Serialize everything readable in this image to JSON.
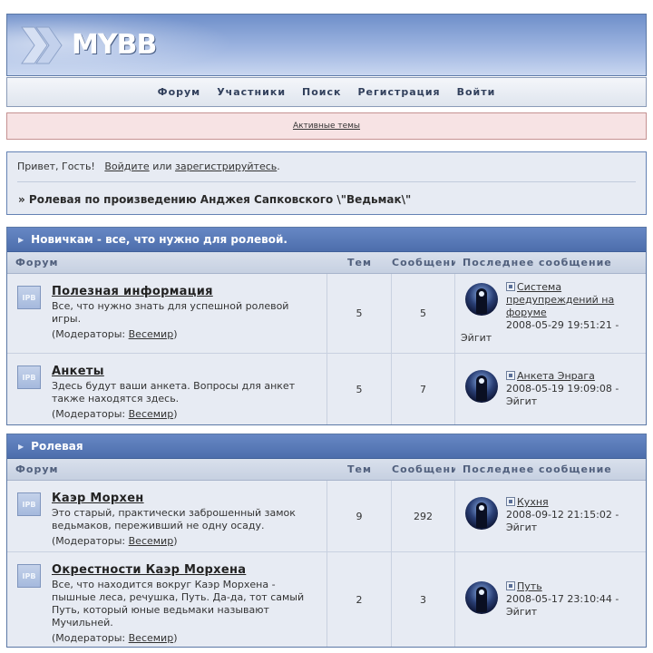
{
  "header": {
    "logo_text": "MYBB"
  },
  "nav": [
    "Форум",
    "Участники",
    "Поиск",
    "Регистрация",
    "Войти"
  ],
  "notice": {
    "link": "Активные темы"
  },
  "welcome": {
    "greet_prefix": "Привет, Гость!",
    "login": "Войдите",
    "or": "или",
    "register": "зарегистрируйтесь",
    "period": ".",
    "board_title": "» Ролевая по произведению Анджея Сапковского \\\"Ведьмак\\\""
  },
  "columns": {
    "forum": "Форум",
    "topics": "Тем",
    "posts": "Сообщений",
    "last": "Последнее сообщение"
  },
  "icons": {
    "forum_icon_text": "IPB"
  },
  "moderators_label": "(Модераторы:",
  "moderators_close": ")",
  "categories": [
    {
      "title": "Новичкам - все, что нужно для ролевой.",
      "forums": [
        {
          "title": "Полезная информация",
          "desc": "Все, что нужно знать для успешной ролевой игры.",
          "moderator": "Весемир",
          "topics": "5",
          "posts": "5",
          "last_topic": "Система предупреждений на форуме",
          "last_date": "2008-05-29 19:51:21 -",
          "last_author": "Эйгит"
        },
        {
          "title": "Анкеты",
          "desc": "Здесь будут ваши анкета. Вопросы для анкет также находятся здесь.",
          "moderator": "Весемир",
          "topics": "5",
          "posts": "7",
          "last_topic": "Анкета Энрага",
          "last_date": "2008-05-19 19:09:08 -",
          "last_author": "Эйгит"
        }
      ]
    },
    {
      "title": "Ролевая",
      "forums": [
        {
          "title": "Каэр Морхен",
          "desc": "Это старый, практически заброшенный замок ведьмаков, переживший не одну осаду.",
          "moderator": "Весемир",
          "topics": "9",
          "posts": "292",
          "last_topic": "Кухня",
          "last_date": "2008-09-12 21:15:02 -",
          "last_author": "Эйгит"
        },
        {
          "title": "Окрестности Каэр Морхена",
          "desc": "Все, что находится вокруг Каэр Морхена - пышные леса, речушка, Путь. Да-да, тот самый Путь, который юные ведьмаки называют Мучильней.",
          "moderator": "Весемир",
          "topics": "2",
          "posts": "3",
          "last_topic": "Путь",
          "last_date": "2008-05-17 23:10:44 -",
          "last_author": "Эйгит"
        }
      ]
    }
  ]
}
